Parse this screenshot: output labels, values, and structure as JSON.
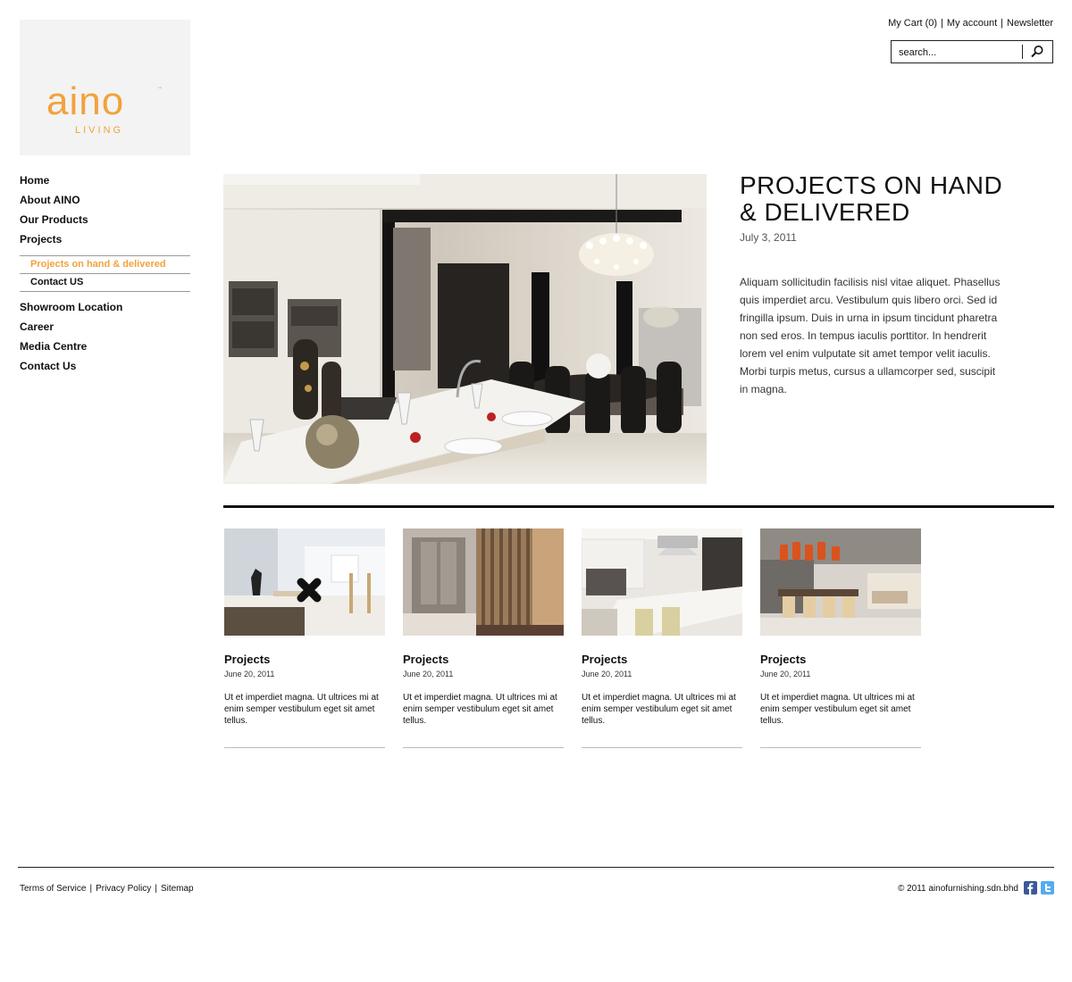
{
  "brand": {
    "logo_word": "aino",
    "logo_tm": "™",
    "logo_sub": "LIVING"
  },
  "top_links": {
    "cart": "My Cart (0)",
    "account": "My account",
    "newsletter": "Newsletter",
    "separator": "|"
  },
  "search": {
    "placeholder": "search...",
    "value": "search..."
  },
  "nav": {
    "items": [
      "Home",
      "About AINO",
      "Our Products",
      "Projects"
    ],
    "sub_items": [
      "Projects on hand & delivered",
      "Contact US"
    ],
    "items_after": [
      "Showroom Location",
      "Career",
      "Media Centre",
      "Contact Us"
    ]
  },
  "hero": {
    "title": "PROJECTS ON HAND & DELIVERED",
    "date": "July 3, 2011",
    "body": "Aliquam sollicitudin facilisis nisl vitae aliquet. Phasellus quis imperdiet arcu. Vestibulum quis libero orci. Sed id fringilla ipsum. Duis in urna in ipsum tincidunt pharetra non sed eros. In tempus iaculis porttitor. In hendrerit lorem vel enim vulputate sit amet tempor velit iaculis. Morbi turpis metus, cursus a ullamcorper sed, suscipit in magna."
  },
  "cards": [
    {
      "title": "Projects",
      "date": "June 20, 2011",
      "text": "Ut et imperdiet magna. Ut ultrices mi at enim semper vestibulum eget sit amet tellus."
    },
    {
      "title": "Projects",
      "date": "June 20, 2011",
      "text": "Ut et imperdiet magna. Ut ultrices mi at enim semper vestibulum eget sit amet tellus."
    },
    {
      "title": "Projects",
      "date": "June 20, 2011",
      "text": "Ut et imperdiet magna. Ut ultrices mi at enim semper vestibulum eget sit amet tellus."
    },
    {
      "title": "Projects",
      "date": "June 20, 2011",
      "text": "Ut et imperdiet magna. Ut ultrices mi at enim semper vestibulum eget sit amet tellus."
    }
  ],
  "footer": {
    "links": [
      "Terms of Service",
      "Privacy Policy",
      "Sitemap"
    ],
    "separator": "|",
    "copyright": "© 2011 ainofurnishing.sdn.bhd"
  },
  "colors": {
    "accent": "#f1a23c",
    "text": "#111111",
    "facebook": "#3b5998",
    "twitter": "#55acee"
  },
  "icons": [
    "search-icon",
    "facebook-icon",
    "twitter-icon"
  ]
}
